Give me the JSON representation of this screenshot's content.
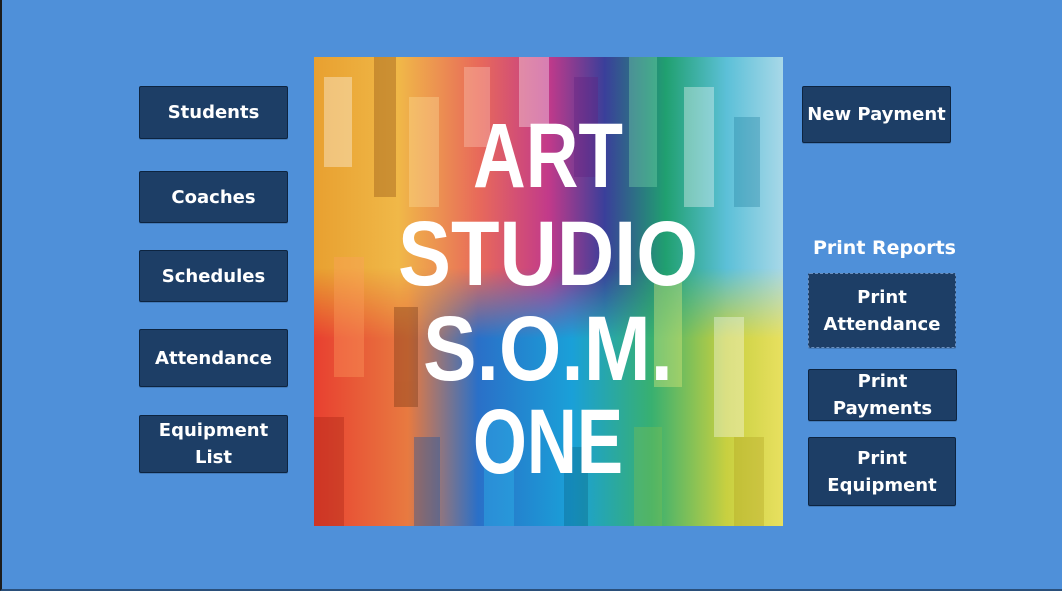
{
  "nav_buttons": {
    "students": "Students",
    "coaches": "Coaches",
    "schedules": "Schedules",
    "attendance": "Attendance",
    "equipment_list": "Equipment List"
  },
  "actions": {
    "new_payment": "New Payment"
  },
  "reports": {
    "heading": "Print Reports",
    "print_attendance": "Print\nAttendance",
    "print_payments": "Print Payments",
    "print_equipment": "Print\nEquipment"
  },
  "logo": {
    "lines": [
      "ART",
      "STUDIO",
      "S.O.M.",
      "ONE"
    ]
  },
  "colors": {
    "background": "#4f90d9",
    "button": "#1d3e66",
    "button_text": "#ffffff"
  }
}
